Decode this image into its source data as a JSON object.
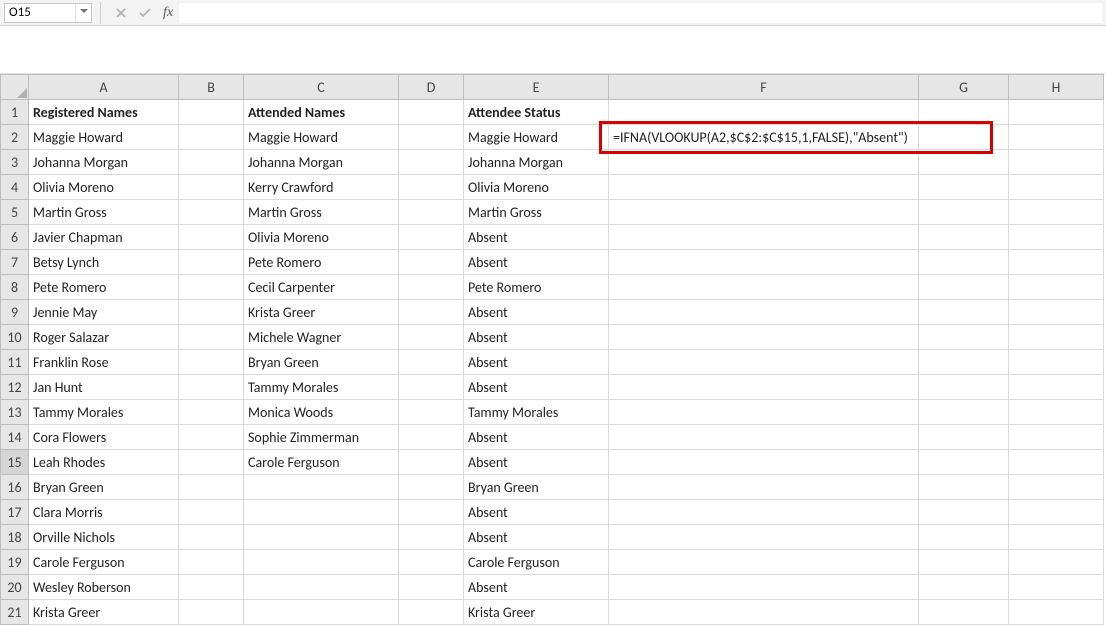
{
  "formula_bar": {
    "name_box": "O15",
    "fx_label": "fx",
    "formula_value": ""
  },
  "columns": [
    "A",
    "B",
    "C",
    "D",
    "E",
    "F",
    "G",
    "H"
  ],
  "headers": {
    "A": "Registered Names",
    "C": "Attended Names",
    "E": "Attendee Status"
  },
  "rows": [
    {
      "n": 1,
      "A": "Registered Names",
      "B": "",
      "C": "Attended Names",
      "D": "",
      "E": "Attendee Status",
      "F": "",
      "bold": true
    },
    {
      "n": 2,
      "A": "Maggie Howard",
      "B": "",
      "C": "Maggie Howard",
      "D": "",
      "E": "Maggie Howard",
      "F": "=IFNA(VLOOKUP(A2,$C$2:$C$15,1,FALSE),\"Absent\")"
    },
    {
      "n": 3,
      "A": "Johanna Morgan",
      "B": "",
      "C": "Johanna Morgan",
      "D": "",
      "E": "Johanna Morgan",
      "F": ""
    },
    {
      "n": 4,
      "A": "Olivia Moreno",
      "B": "",
      "C": "Kerry Crawford",
      "D": "",
      "E": "Olivia Moreno",
      "F": ""
    },
    {
      "n": 5,
      "A": "Martin Gross",
      "B": "",
      "C": "Martin Gross",
      "D": "",
      "E": "Martin Gross",
      "F": ""
    },
    {
      "n": 6,
      "A": "Javier Chapman",
      "B": "",
      "C": "Olivia Moreno",
      "D": "",
      "E": "Absent",
      "F": ""
    },
    {
      "n": 7,
      "A": "Betsy Lynch",
      "B": "",
      "C": "Pete Romero",
      "D": "",
      "E": "Absent",
      "F": ""
    },
    {
      "n": 8,
      "A": "Pete Romero",
      "B": "",
      "C": "Cecil Carpenter",
      "D": "",
      "E": "Pete Romero",
      "F": ""
    },
    {
      "n": 9,
      "A": "Jennie May",
      "B": "",
      "C": "Krista Greer",
      "D": "",
      "E": "Absent",
      "F": ""
    },
    {
      "n": 10,
      "A": "Roger Salazar",
      "B": "",
      "C": "Michele Wagner",
      "D": "",
      "E": "Absent",
      "F": ""
    },
    {
      "n": 11,
      "A": "Franklin Rose",
      "B": "",
      "C": "Bryan Green",
      "D": "",
      "E": "Absent",
      "F": ""
    },
    {
      "n": 12,
      "A": "Jan Hunt",
      "B": "",
      "C": "Tammy Morales",
      "D": "",
      "E": "Absent",
      "F": ""
    },
    {
      "n": 13,
      "A": "Tammy Morales",
      "B": "",
      "C": "Monica Woods",
      "D": "",
      "E": "Tammy Morales",
      "F": ""
    },
    {
      "n": 14,
      "A": "Cora Flowers",
      "B": "",
      "C": "Sophie Zimmerman",
      "D": "",
      "E": "Absent",
      "F": ""
    },
    {
      "n": 15,
      "A": "Leah Rhodes",
      "B": "",
      "C": "Carole Ferguson",
      "D": "",
      "E": "Absent",
      "F": ""
    },
    {
      "n": 16,
      "A": "Bryan Green",
      "B": "",
      "C": "",
      "D": "",
      "E": "Bryan Green",
      "F": ""
    },
    {
      "n": 17,
      "A": "Clara Morris",
      "B": "",
      "C": "",
      "D": "",
      "E": "Absent",
      "F": ""
    },
    {
      "n": 18,
      "A": "Orville Nichols",
      "B": "",
      "C": "",
      "D": "",
      "E": "Absent",
      "F": ""
    },
    {
      "n": 19,
      "A": "Carole Ferguson",
      "B": "",
      "C": "",
      "D": "",
      "E": "Carole Ferguson",
      "F": ""
    },
    {
      "n": 20,
      "A": "Wesley Roberson",
      "B": "",
      "C": "",
      "D": "",
      "E": "Absent",
      "F": ""
    },
    {
      "n": 21,
      "A": "Krista Greer",
      "B": "",
      "C": "",
      "D": "",
      "E": "Krista Greer",
      "F": ""
    }
  ],
  "selected_row": 15,
  "highlight_cell": "F2"
}
